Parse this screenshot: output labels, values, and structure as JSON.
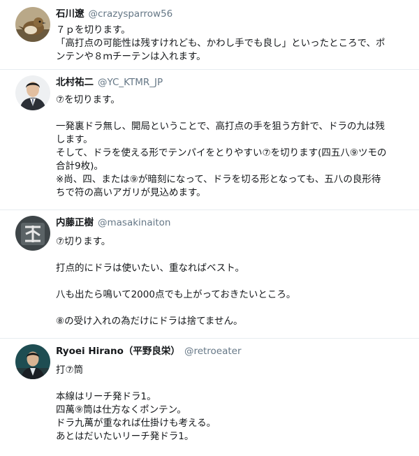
{
  "tweets": [
    {
      "name": "石川遼",
      "handle": "@crazysparrow56",
      "avatar_icon": "sparrow-bird-avatar",
      "lines": [
        "７ｐを切ります。",
        "「高打点の可能性は残すけれども、かわし手でも良し」といったところで、ポ",
        "ンテンや８ｍチーテンは入れます。"
      ]
    },
    {
      "name": "北村祐二",
      "handle": "@YC_KTMR_JP",
      "avatar_icon": "man-in-suit-avatar",
      "lines": [
        "⑦を切ります。",
        "",
        "一発裏ドラ無し、開局ということで、高打点の手を狙う方針で、ドラの九は残",
        "します。",
        "そして、ドラを使える形でテンパイをとりやすい⑦を切ります(四五八⑨ツモの",
        "合計9枚)。",
        "※尚、四、または⑨が暗刻になって、ドラを切る形となっても、五八の良形待",
        "ちで符の高いアガリが見込めます。"
      ]
    },
    {
      "name": "内藤正樹",
      "handle": "@masakinaiton",
      "avatar_icon": "kanji-logo-avatar",
      "lines": [
        "⑦切ります。",
        "",
        "打点的にドラは使いたい、重なればベスト。",
        "",
        "八も出たら鳴いて2000点でも上がっておきたいところ。",
        "",
        "⑧の受け入れの為だけにドラは捨てません。"
      ]
    },
    {
      "name": "Ryoei Hirano（平野良栄）",
      "handle": "@retroeater",
      "avatar_icon": "man-in-suit-avatar",
      "lines": [
        "打⑦筒",
        "",
        "本線はリーチ発ドラ1。",
        "四萬⑨筒は仕方なくポンテン。",
        "ドラ九萬が重なれば仕掛けも考える。",
        "あとはだいたいリーチ発ドラ1。"
      ]
    }
  ]
}
